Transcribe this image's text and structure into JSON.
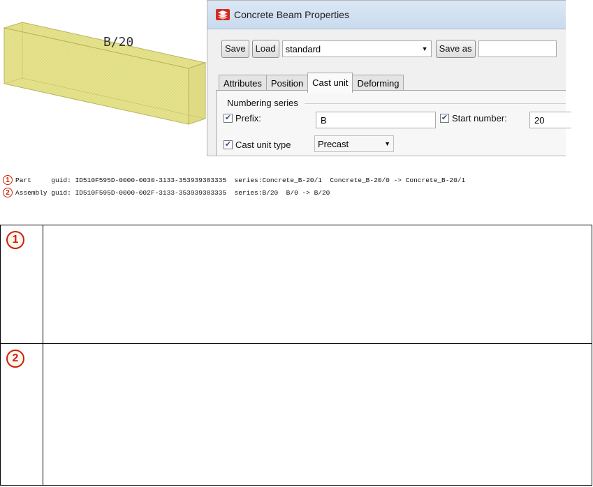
{
  "model_view": {
    "beam_label": "B/20",
    "beam_color": "#e6e38f"
  },
  "dialog": {
    "title": "Concrete Beam Properties",
    "icon": "tekla-app-icon",
    "toolbar": {
      "save_label": "Save",
      "load_label": "Load",
      "preset_value": "standard",
      "save_as_label": "Save as",
      "save_as_value": ""
    },
    "tabs": [
      {
        "label": "Attributes",
        "active": false
      },
      {
        "label": "Position",
        "active": false
      },
      {
        "label": "Cast unit",
        "active": true
      },
      {
        "label": "Deforming",
        "active": false
      }
    ],
    "cast_unit": {
      "group_title": "Numbering series",
      "prefix_label": "Prefix:",
      "prefix_checked": true,
      "prefix_value": "B",
      "start_number_label": "Start number:",
      "start_number_checked": true,
      "start_number_value": "20",
      "cast_unit_type_label": "Cast unit type",
      "cast_unit_type_checked": true,
      "cast_unit_type_value": "Precast"
    }
  },
  "log": [
    {
      "number": "1",
      "text": "Part     guid: ID510F595D-0000-0030-3133-353939383335  series:Concrete_B-20/1  Concrete_B-20/0 -> Concrete_B-20/1"
    },
    {
      "number": "2",
      "text": "Assembly guid: ID510F595D-0000-002F-3133-353939383335  series:B/20  B/0 -> B/20"
    }
  ],
  "notes_table": [
    {
      "number": "1",
      "text": ""
    },
    {
      "number": "2",
      "text": ""
    }
  ],
  "colors": {
    "accent_red": "#cc2200",
    "checkbox_check": "#2b4f91"
  }
}
